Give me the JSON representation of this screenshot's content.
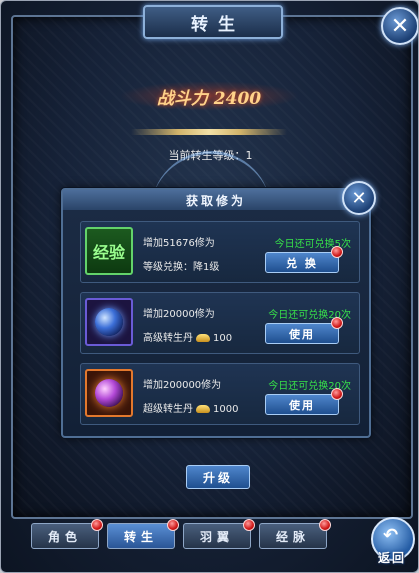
{
  "window": {
    "title": "转生"
  },
  "header": {
    "power_text": "战斗力 2400",
    "level_text": "当前转生等级：1"
  },
  "dialog": {
    "title": "获取修为",
    "items": [
      {
        "icon_label": "经验",
        "line1": "增加51676修为",
        "line2": "等级兑换：降1级",
        "limit": "今日还可兑换5次",
        "button": "兑 换"
      },
      {
        "icon_label": "",
        "line1": "增加20000修为",
        "line2": "高级转生丹",
        "cost": "100",
        "limit": "今日还可兑换20次",
        "button": "使用"
      },
      {
        "icon_label": "",
        "line1": "增加200000修为",
        "line2": "超级转生丹",
        "cost": "1000",
        "limit": "今日还可兑换20次",
        "button": "使用"
      }
    ]
  },
  "upgrade_button": "升级",
  "tabs": [
    {
      "label": "角色"
    },
    {
      "label": "转生"
    },
    {
      "label": "羽翼"
    },
    {
      "label": "经脉"
    }
  ],
  "back_button": "返回",
  "icons": [
    "close-icon",
    "back-arrow-icon",
    "coin-icon",
    "notification-dot"
  ]
}
